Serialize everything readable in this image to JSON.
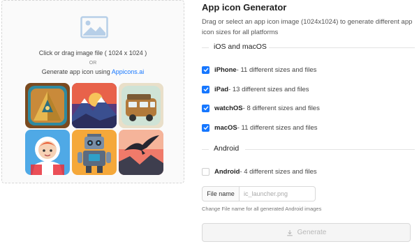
{
  "dropzone": {
    "icon": "image-icon",
    "instruction": "Click or drag image file ( 1024 x 1024 )",
    "or": "OR",
    "generate_prefix": "Generate app icon using ",
    "generate_link": "Appicons.ai"
  },
  "samples": [
    {
      "icon": "pyramid-icon"
    },
    {
      "icon": "mountain-sunset-icon"
    },
    {
      "icon": "camper-van-icon"
    },
    {
      "icon": "astronaut-girl-icon"
    },
    {
      "icon": "robot-icon"
    },
    {
      "icon": "eagle-icon"
    }
  ],
  "panel": {
    "title": "App icon Generator",
    "description": "Drag or select an app icon image (1024x1024) to generate different app icon sizes for all platforms",
    "ios_section": "iOS and macOS",
    "android_section": "Android",
    "options": [
      {
        "name": "iPhone",
        "detail": " - 11 different sizes and files",
        "checked": true
      },
      {
        "name": "iPad",
        "detail": " - 13 different sizes and files",
        "checked": true
      },
      {
        "name": "watchOS",
        "detail": " - 8 different sizes and files",
        "checked": true
      },
      {
        "name": "macOS",
        "detail": " - 11 different sizes and files",
        "checked": true
      },
      {
        "name": "Android",
        "detail": " - 4 different sizes and files",
        "checked": false
      }
    ],
    "file_name_label": "File name",
    "file_name_placeholder": "ic_launcher.png",
    "file_name_hint": "Change File name for all generated Android images",
    "generate_button": "Generate",
    "generate_icon": "download-icon"
  },
  "colors": {
    "accent": "#1677ff",
    "disabled_text": "#b8b8b8"
  }
}
